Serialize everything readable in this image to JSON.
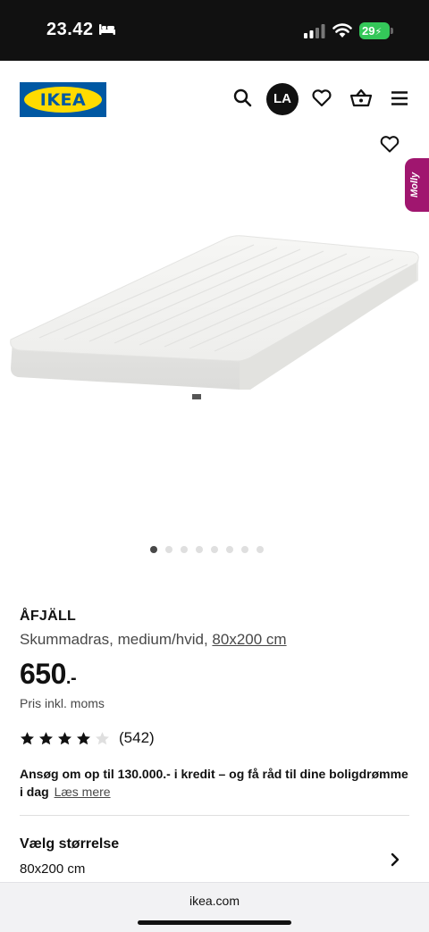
{
  "status_bar": {
    "time": "23.42",
    "battery": "29"
  },
  "header": {
    "logo_text": "IKEA",
    "avatar_initials": "LA",
    "icons": [
      "search-icon",
      "heart-icon",
      "basket-icon",
      "menu-icon"
    ]
  },
  "gallery": {
    "assistant_tab": "Molly",
    "image_count": 8,
    "active_index": 0
  },
  "product": {
    "name": "ÅFJÄLL",
    "description": "Skummadras, medium/hvid,",
    "size_link": "80x200 cm",
    "price": "650",
    "price_suffix": ".-",
    "vat_note": "Pris inkl. moms",
    "rating_stars": 4,
    "rating_max": 5,
    "review_count": "(542)"
  },
  "credit": {
    "text": "Ansøg om op til 130.000.- i kredit – og få råd til dine boligdrømme i dag",
    "link": "Læs mere"
  },
  "size_selector": {
    "title": "Vælg størrelse",
    "value": "80x200 cm"
  },
  "browser": {
    "url": "ikea.com"
  },
  "colors": {
    "ikea_blue": "#0058a3",
    "ikea_yellow": "#ffdb00",
    "molly_purple": "#a0166f",
    "battery_green": "#34c759"
  }
}
